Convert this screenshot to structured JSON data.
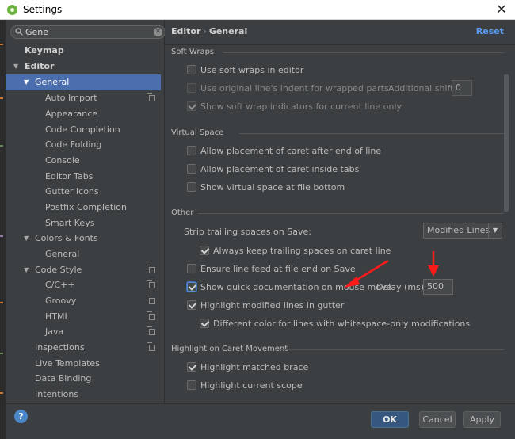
{
  "window": {
    "title": "Settings",
    "close_glyph": "✕"
  },
  "search": {
    "value": "Gene",
    "clear_glyph": "✕"
  },
  "tree": {
    "keymap": "Keymap",
    "editor": "Editor",
    "general": "General",
    "auto_import": "Auto Import",
    "appearance": "Appearance",
    "code_completion": "Code Completion",
    "code_folding": "Code Folding",
    "console": "Console",
    "editor_tabs": "Editor Tabs",
    "gutter_icons": "Gutter Icons",
    "postfix_completion": "Postfix Completion",
    "smart_keys": "Smart Keys",
    "colors_fonts": "Colors & Fonts",
    "colors_general": "General",
    "code_style": "Code Style",
    "c_cpp": "C/C++",
    "groovy": "Groovy",
    "html": "HTML",
    "java": "Java",
    "inspections": "Inspections",
    "live_templates": "Live Templates",
    "data_binding": "Data Binding",
    "intentions": "Intentions"
  },
  "content": {
    "breadcrumb": {
      "parent": "Editor",
      "sep": "›",
      "current": "General"
    },
    "reset": "Reset",
    "soft_wraps": {
      "title": "Soft Wraps",
      "use_soft_wraps": "Use soft wraps in editor",
      "use_original_indent": "Use original line's indent for wrapped parts",
      "additional_shift_label": "Additional shift:",
      "additional_shift_value": "0",
      "show_indicators": "Show soft wrap indicators for current line only"
    },
    "virtual_space": {
      "title": "Virtual Space",
      "after_end_of_line": "Allow placement of caret after end of line",
      "inside_tabs": "Allow placement of caret inside tabs",
      "show_at_file_bottom": "Show virtual space at file bottom"
    },
    "other": {
      "title": "Other",
      "strip_label": "Strip trailing spaces on Save:",
      "strip_value": "Modified Lines",
      "always_keep": "Always keep trailing spaces on caret line",
      "ensure_line_feed": "Ensure line feed at file end on Save",
      "quick_doc": "Show quick documentation on mouse move",
      "delay_label": "Delay (ms):",
      "delay_value": "500",
      "highlight_modified": "Highlight modified lines in gutter",
      "different_color": "Different color for lines with whitespace-only modifications"
    },
    "caret_movement": {
      "title": "Highlight on Caret Movement",
      "matched_brace": "Highlight matched brace",
      "current_scope": "Highlight current scope"
    }
  },
  "footer": {
    "help": "?",
    "ok": "OK",
    "cancel": "Cancel",
    "apply": "Apply"
  },
  "checkboxes": {
    "use_soft_wraps": false,
    "use_original_indent": false,
    "show_indicators": true,
    "after_end_of_line": false,
    "inside_tabs": false,
    "show_at_file_bottom": false,
    "always_keep": true,
    "ensure_line_feed": false,
    "quick_doc": true,
    "highlight_modified": true,
    "different_color": true,
    "matched_brace": true,
    "current_scope": false
  },
  "colors": {
    "selection": "#4b6eaf",
    "link": "#589df6",
    "annotation_arrow": "#ff1a1a",
    "ok_button": "#365880"
  }
}
